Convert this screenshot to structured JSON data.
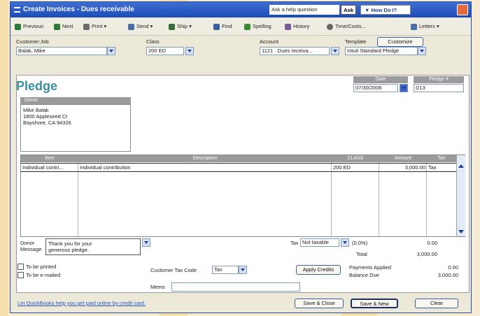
{
  "window": {
    "title": "Create Invoices - Dues receivable",
    "ask_placeholder": "Ask a help question",
    "ask_button": "Ask",
    "how_do_i": "How Do I?"
  },
  "toolbar": [
    {
      "label": "Previous",
      "icon": "previous-icon",
      "color": "#2d7a3a"
    },
    {
      "label": "Next",
      "icon": "next-icon",
      "color": "#2d7a3a"
    },
    {
      "label": "Print",
      "icon": "printer-icon",
      "color": "#6b6b6b"
    },
    {
      "label": "Send",
      "icon": "send-icon",
      "color": "#4a6ea8"
    },
    {
      "label": "Ship",
      "icon": "ship-icon",
      "color": "#3a6b3a"
    },
    {
      "label": "Find",
      "icon": "find-icon",
      "color": "#3a5fa0"
    },
    {
      "label": "Spelling",
      "icon": "spelling-icon",
      "color": "#3a8a3a"
    },
    {
      "label": "History",
      "icon": "history-icon",
      "color": "#7a5a9a"
    },
    {
      "label": "Time/Costs...",
      "icon": "clock-icon",
      "color": "#666666"
    },
    {
      "label": "Letters",
      "icon": "letters-icon",
      "color": "#4a6ea8"
    }
  ],
  "header": {
    "customer_label": "Customer:Job",
    "customer_value": "Balak, Mike",
    "class_label": "Class",
    "class_value": "200 ED",
    "account_label": "Account",
    "account_value": "1121 · Dues receiva...",
    "template_label": "Template",
    "template_value": "Intuit Standard Pledge",
    "customize_label": "Customize"
  },
  "form": {
    "heading": "Pledge",
    "date_label": "Date",
    "date_value": "07/30/2006",
    "pledge_no_label": "Pledge #",
    "pledge_no_value": "D13",
    "donor_label": "Donor",
    "donor_lines": [
      "Mike Balak",
      "1800 Appleseed Ct",
      "Bayshore, CA 94326"
    ]
  },
  "table": {
    "columns": [
      "Item",
      "Description",
      "CLASS",
      "Amount",
      "Tax"
    ],
    "rows": [
      {
        "item": "Individual contri...",
        "description": "Individual contribution",
        "class": "200 ED",
        "amount": "3,000.00",
        "tax": "Tax"
      }
    ]
  },
  "footer": {
    "donor_message_label_1": "Donor",
    "donor_message_label_2": "Message",
    "donor_message_line1": "Thank you for your",
    "donor_message_line2": "generous pledge.",
    "tax_label": "Tax",
    "tax_value": "Not taxable",
    "tax_rate": "(0.0%)",
    "tax_amount": "0.00",
    "total_label": "Total",
    "total_value": "3,000.00"
  },
  "bottom": {
    "to_be_printed": "To be printed",
    "to_be_emailed": "To be e-mailed",
    "tax_code_label": "Customer Tax Code",
    "tax_code_value": "Tax",
    "apply_credits": "Apply Credits",
    "payments_applied_label": "Payments Applied",
    "payments_applied_value": "0.00",
    "balance_due_label": "Balance Due",
    "balance_due_value": "3,000.00",
    "memo_label": "Memo",
    "link_text": "Let QuickBooks help you get paid online by credit card.",
    "save_close": "Save & Close",
    "save_new": "Save & New",
    "clear": "Clear"
  }
}
